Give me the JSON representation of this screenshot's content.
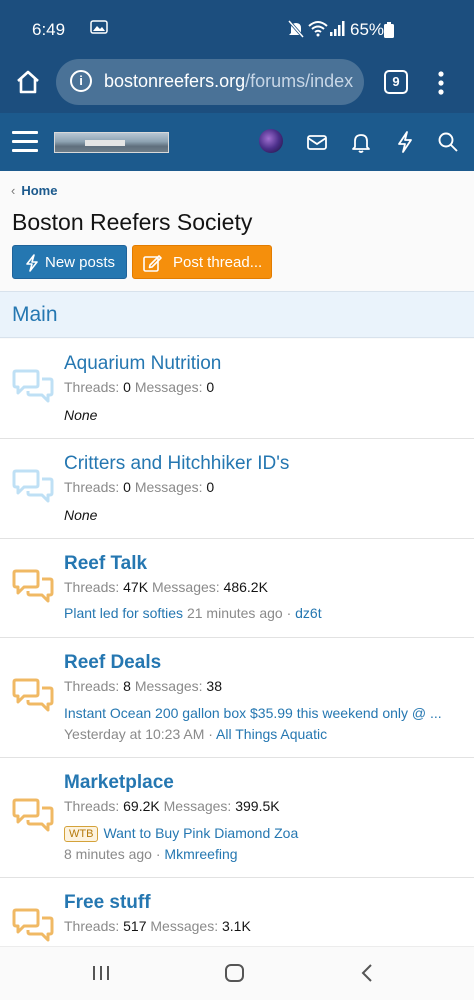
{
  "status_bar": {
    "time": "6:49",
    "battery_percent": "65%"
  },
  "browser": {
    "url_host": "bostonreefers.org",
    "url_path": "/forums/index.|",
    "tab_count": "9"
  },
  "breadcrumb": {
    "home_label": "Home"
  },
  "page": {
    "title": "Boston Reefers Society"
  },
  "buttons": {
    "new_posts": "New posts",
    "post_thread": "Post thread..."
  },
  "section": {
    "title": "Main"
  },
  "nodes": [
    {
      "title": "Aquarium Nutrition",
      "threads_label": "Threads:",
      "threads": "0",
      "messages_label": "Messages:",
      "messages": "0",
      "latest": "None"
    },
    {
      "title": "Critters and Hitchhiker ID's",
      "threads_label": "Threads:",
      "threads": "0",
      "messages_label": "Messages:",
      "messages": "0",
      "latest": "None"
    },
    {
      "title": "Reef Talk",
      "threads_label": "Threads:",
      "threads": "47K",
      "messages_label": "Messages:",
      "messages": "486.2K",
      "latest_title": "Plant led for softies",
      "latest_time": "21 minutes ago",
      "latest_sep": "·",
      "latest_user": "dz6t"
    },
    {
      "title": "Reef Deals",
      "threads_label": "Threads:",
      "threads": "8",
      "messages_label": "Messages:",
      "messages": "38",
      "latest_title": "Instant Ocean 200 gallon box $35.99 this weekend only @ ...",
      "latest_time": "Yesterday at 10:23 AM",
      "latest_sep": "·",
      "latest_user": "All Things Aquatic"
    },
    {
      "title": "Marketplace",
      "threads_label": "Threads:",
      "threads": "69.2K",
      "messages_label": "Messages:",
      "messages": "399.5K",
      "latest_prefix": "WTB",
      "latest_title": "Want to Buy Pink Diamond Zoa",
      "latest_time": "8 minutes ago",
      "latest_sep": "·",
      "latest_user": "Mkmreefing"
    },
    {
      "title": "Free stuff",
      "threads_label": "Threads:",
      "threads": "517",
      "messages_label": "Messages:",
      "messages": "3.1K"
    }
  ],
  "colors": {
    "header": "#1c4e7e",
    "nav": "#1c5a8d",
    "link": "#2577b1",
    "accent_orange": "#f58f0c",
    "unread_icon": "#f0b964",
    "read_icon": "#bfe0f5"
  }
}
